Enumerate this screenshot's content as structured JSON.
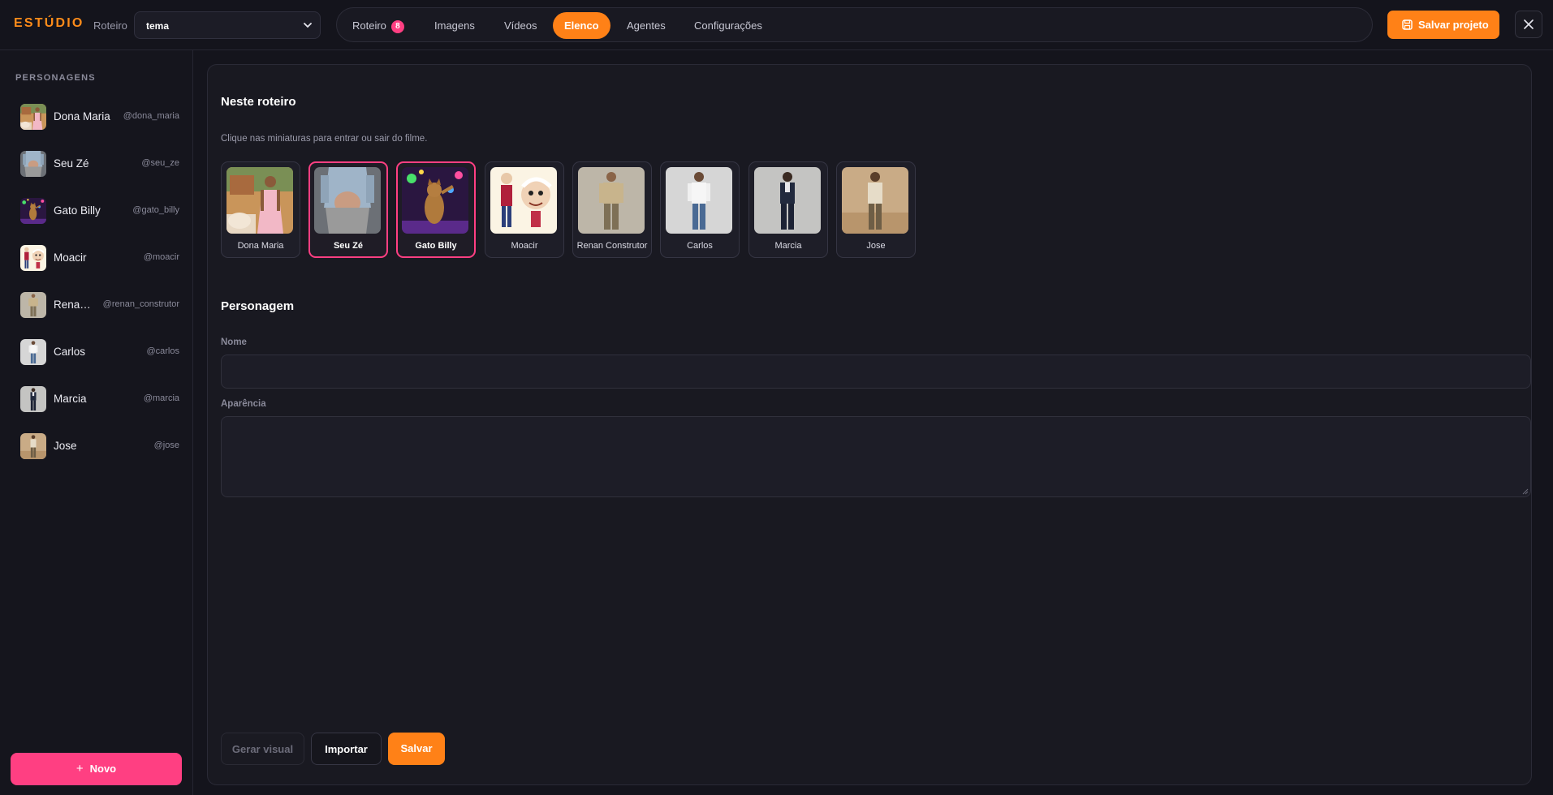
{
  "header": {
    "brand": "ESTÚDIO",
    "roteiro_label": "Roteiro",
    "roteiro_select_value": "tema",
    "tabs": [
      {
        "label": "Roteiro",
        "badge": "8",
        "active": false
      },
      {
        "label": "Imagens",
        "active": false
      },
      {
        "label": "Vídeos",
        "active": false
      },
      {
        "label": "Elenco",
        "active": true
      },
      {
        "label": "Agentes",
        "active": false
      },
      {
        "label": "Configurações",
        "active": false
      }
    ],
    "save_project_label": "Salvar projeto",
    "close_icon": "close-icon",
    "save_icon": "save-icon"
  },
  "sidebar": {
    "heading": "PERSONAGENS",
    "characters": [
      {
        "name": "Dona Maria",
        "handle": "@dona_maria"
      },
      {
        "name": "Seu Zé",
        "handle": "@seu_ze"
      },
      {
        "name": "Gato Billy",
        "handle": "@gato_billy"
      },
      {
        "name": "Moacir",
        "handle": "@moacir"
      },
      {
        "name": "Renan Construtor",
        "handle": "@renan_construtor"
      },
      {
        "name": "Carlos",
        "handle": "@carlos"
      },
      {
        "name": "Marcia",
        "handle": "@marcia"
      },
      {
        "name": "Jose",
        "handle": "@jose"
      }
    ],
    "new_button_label": "Novo"
  },
  "main": {
    "cast_section_title": "Neste roteiro",
    "cast_hint": "Clique nas miniaturas para entrar ou sair do filme.",
    "cast": [
      {
        "name": "Dona Maria",
        "selected": false
      },
      {
        "name": "Seu Zé",
        "selected": true
      },
      {
        "name": "Gato Billy",
        "selected": true
      },
      {
        "name": "Moacir",
        "selected": false
      },
      {
        "name": "Renan Construtor",
        "selected": false
      },
      {
        "name": "Carlos",
        "selected": false
      },
      {
        "name": "Marcia",
        "selected": false
      },
      {
        "name": "Jose",
        "selected": false
      }
    ],
    "character_section_title": "Personagem",
    "name_label": "Nome",
    "name_value": "",
    "appearance_label": "Aparência",
    "appearance_value": "",
    "generate_visual_label": "Gerar visual",
    "import_label": "Importar",
    "save_label": "Salvar"
  },
  "colors": {
    "accent_orange": "#ff8117",
    "accent_pink": "#ff3f82",
    "background": "#14141c"
  }
}
